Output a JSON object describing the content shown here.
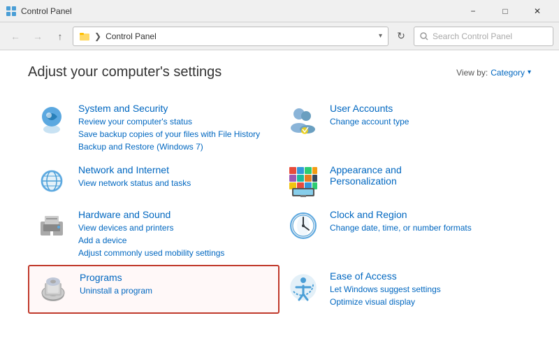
{
  "titlebar": {
    "icon": "control-panel-icon",
    "title": "Control Panel",
    "minimize_label": "−",
    "maximize_label": "□",
    "close_label": "✕"
  },
  "addressbar": {
    "back_label": "←",
    "forward_label": "→",
    "up_label": "↑",
    "breadcrumb": "Control Panel",
    "dropdown_label": "▾",
    "refresh_label": "↻",
    "search_placeholder": "Search Control Panel"
  },
  "content": {
    "page_title": "Adjust your computer's settings",
    "view_by_label": "View by:",
    "view_by_value": "Category",
    "categories": [
      {
        "id": "system-security",
        "title": "System and Security",
        "links": [
          "Review your computer's status",
          "Save backup copies of your files with File History",
          "Backup and Restore (Windows 7)"
        ],
        "highlighted": false
      },
      {
        "id": "user-accounts",
        "title": "User Accounts",
        "links": [
          "Change account type"
        ],
        "highlighted": false
      },
      {
        "id": "network-internet",
        "title": "Network and Internet",
        "links": [
          "View network status and tasks"
        ],
        "highlighted": false
      },
      {
        "id": "appearance",
        "title": "Appearance and Personalization",
        "links": [],
        "highlighted": false
      },
      {
        "id": "hardware-sound",
        "title": "Hardware and Sound",
        "links": [
          "View devices and printers",
          "Add a device",
          "Adjust commonly used mobility settings"
        ],
        "highlighted": false
      },
      {
        "id": "clock-region",
        "title": "Clock and Region",
        "links": [
          "Change date, time, or number formats"
        ],
        "highlighted": false
      },
      {
        "id": "programs",
        "title": "Programs",
        "links": [
          "Uninstall a program"
        ],
        "highlighted": true
      },
      {
        "id": "ease-of-access",
        "title": "Ease of Access",
        "links": [
          "Let Windows suggest settings",
          "Optimize visual display"
        ],
        "highlighted": false
      }
    ]
  }
}
